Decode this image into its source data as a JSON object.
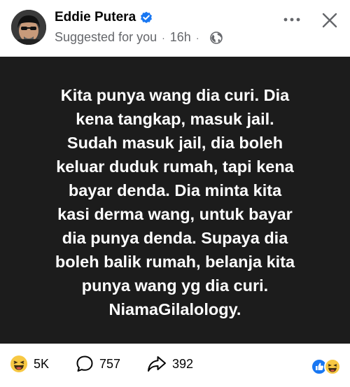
{
  "post_header": {
    "author_name": "Eddie Putera",
    "suggested_label": "Suggested for you",
    "separator": "·",
    "time_ago": "16h",
    "audience_icon": "globe-icon",
    "verified_icon": "verified-badge-icon",
    "more_icon": "more-options-icon",
    "close_icon": "close-icon"
  },
  "post_body": {
    "background_color": "#1c1c1c",
    "text_color": "#ffffff",
    "lines": [
      "Kita punya wang dia curi. Dia",
      "kena tangkap, masuk jail.",
      "Sudah masuk jail, dia boleh",
      "keluar duduk rumah, tapi kena",
      "bayar denda. Dia minta kita",
      "kasi derma wang, untuk bayar",
      "dia punya denda. Supaya dia",
      "boleh balik rumah, belanja kita",
      "punya wang yg dia curi.",
      "NiamaGilalology."
    ]
  },
  "post_footer": {
    "reactions_count": "5K",
    "comments_count": "757",
    "shares_count": "392",
    "reaction_icon": "laughing-emoji-icon",
    "comment_icon": "comment-icon",
    "share_icon": "share-icon",
    "reaction_summary_icons": [
      "like-icon",
      "laughing-emoji-icon"
    ],
    "accent_color": "#1877f2"
  }
}
